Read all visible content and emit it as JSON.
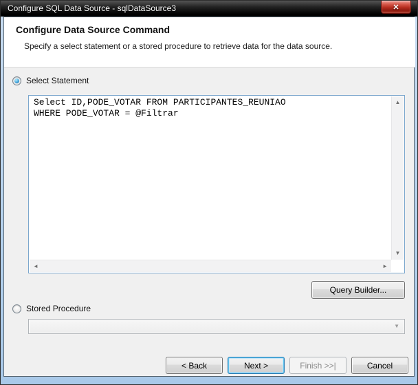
{
  "window": {
    "title": "Configure SQL Data Source - sqlDataSource3"
  },
  "header": {
    "title": "Configure Data Source Command",
    "subtitle": "Specify a select statement or a stored procedure to retrieve data for the data source."
  },
  "form": {
    "select_statement_label": "Select Statement",
    "select_statement_selected": true,
    "sql_text": "Select ID,PODE_VOTAR FROM PARTICIPANTES_REUNIAO\nWHERE PODE_VOTAR = @Filtrar",
    "query_builder_label": "Query Builder...",
    "stored_procedure_label": "Stored Procedure",
    "stored_procedure_selected": false,
    "stored_procedure_value": ""
  },
  "footer": {
    "back_label": "< Back",
    "next_label": "Next >",
    "finish_label": "Finish >>|",
    "cancel_label": "Cancel"
  },
  "icons": {
    "close": "✕",
    "scroll_up": "▲",
    "scroll_down": "▼",
    "scroll_left": "◄",
    "scroll_right": "►",
    "dropdown": "▼"
  },
  "colors": {
    "titlebar_bg": "#1a1a1a",
    "close_button_red": "#b52c1e",
    "frame_blue": "#b5d2ee",
    "body_bg": "#f0f0f0",
    "textarea_focus_border": "#7ca7cd",
    "default_button_border": "#2d7db4",
    "disabled_text": "#8a8a8a"
  }
}
